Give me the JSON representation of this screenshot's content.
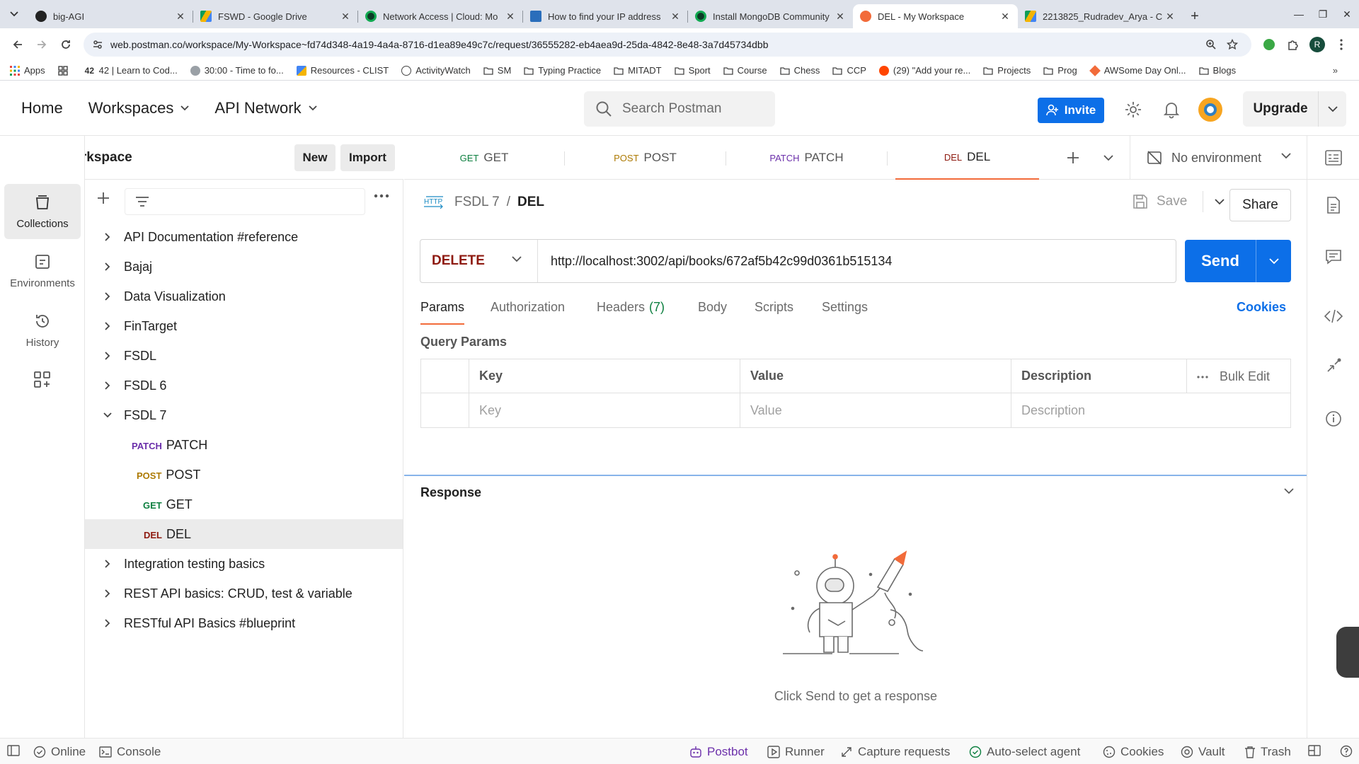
{
  "browser": {
    "tabs": [
      {
        "title": "big-AGI",
        "favicon_color": "#222222"
      },
      {
        "title": "FSWD - Google Drive",
        "favicon_color": "#f4b400"
      },
      {
        "title": "Network Access | Cloud: Mo",
        "favicon_color": "#13aa52"
      },
      {
        "title": "How to find your IP address",
        "favicon_color": "#2a6ebb"
      },
      {
        "title": "Install MongoDB Community",
        "favicon_color": "#13aa52"
      },
      {
        "title": "DEL - My Workspace",
        "favicon_color": "#f26b3a",
        "active": true
      },
      {
        "title": "2213825_Rudradev_Arya - C",
        "favicon_color": "#f4b400"
      }
    ],
    "url": "web.postman.co/workspace/My-Workspace~fd74d348-4a19-4a4a-8716-d1ea89e49c7c/request/36555282-eb4aea9d-25da-4842-8e48-3a7d45734dbb",
    "profile_initial": "R",
    "bookmarks": [
      {
        "label": "Apps",
        "icon": "apps-grid-icon"
      },
      {
        "label": "",
        "icon": "grid-icon"
      },
      {
        "label": "42 | Learn to Cod...",
        "icon": "code-icon"
      },
      {
        "label": "30:00 - Time to fo...",
        "icon": "timer-icon"
      },
      {
        "label": "Resources - CLIST",
        "icon": "clist-icon"
      },
      {
        "label": "ActivityWatch",
        "icon": "activitywatch-icon"
      },
      {
        "label": "SM",
        "icon": "folder-icon"
      },
      {
        "label": "Typing Practice",
        "icon": "folder-icon"
      },
      {
        "label": "MITADT",
        "icon": "folder-icon"
      },
      {
        "label": "Sport",
        "icon": "folder-icon"
      },
      {
        "label": "Course",
        "icon": "folder-icon"
      },
      {
        "label": "Chess",
        "icon": "folder-icon"
      },
      {
        "label": "CCP",
        "icon": "folder-icon"
      },
      {
        "label": "(29) \"Add your re...",
        "icon": "reddit-icon"
      },
      {
        "label": "Projects",
        "icon": "folder-icon"
      },
      {
        "label": "Prog",
        "icon": "folder-icon"
      },
      {
        "label": "AWSome Day Onl...",
        "icon": "aws-icon"
      },
      {
        "label": "Blogs",
        "icon": "folder-icon"
      }
    ]
  },
  "header": {
    "nav": {
      "home": "Home",
      "workspaces": "Workspaces",
      "api_network": "API Network"
    },
    "search_placeholder": "Search Postman",
    "invite": "Invite",
    "upgrade": "Upgrade"
  },
  "workspace": {
    "name": "My Workspace",
    "new": "New",
    "import": "Import"
  },
  "rail": {
    "collections": "Collections",
    "environments": "Environments",
    "history": "History"
  },
  "tree": [
    {
      "label": "API Documentation #reference",
      "type": "collection",
      "expanded": false
    },
    {
      "label": "Bajaj",
      "type": "collection",
      "expanded": false
    },
    {
      "label": "Data Visualization",
      "type": "collection",
      "expanded": false
    },
    {
      "label": "FinTarget",
      "type": "collection",
      "expanded": false
    },
    {
      "label": "FSDL",
      "type": "collection",
      "expanded": false
    },
    {
      "label": "FSDL 6",
      "type": "collection",
      "expanded": false
    },
    {
      "label": "FSDL 7",
      "type": "collection",
      "expanded": true
    },
    {
      "label": "PATCH",
      "type": "request",
      "method": "PATCH"
    },
    {
      "label": "POST",
      "type": "request",
      "method": "POST"
    },
    {
      "label": "GET",
      "type": "request",
      "method": "GET"
    },
    {
      "label": "DEL",
      "type": "request",
      "method": "DEL",
      "active": true
    },
    {
      "label": "Integration testing basics",
      "type": "collection",
      "expanded": false
    },
    {
      "label": "REST API basics: CRUD, test & variable",
      "type": "collection",
      "expanded": false
    },
    {
      "label": "RESTful API Basics #blueprint",
      "type": "collection",
      "expanded": false
    }
  ],
  "request_tabs": [
    {
      "method": "GET",
      "label": "GET"
    },
    {
      "method": "POST",
      "label": "POST"
    },
    {
      "method": "PATCH",
      "label": "PATCH"
    },
    {
      "method": "DEL",
      "label": "DEL",
      "active": true
    }
  ],
  "environment": "No environment",
  "request": {
    "http_badge": "HTTP",
    "collection": "FSDL 7",
    "separator": "/",
    "name": "DEL",
    "save": "Save",
    "share": "Share",
    "method": "DELETE",
    "url": "http://localhost:3002/api/books/672af5b42c99d0361b515134",
    "send": "Send",
    "subtabs": {
      "params": "Params",
      "authorization": "Authorization",
      "headers": "Headers",
      "headers_count": "(7)",
      "body": "Body",
      "scripts": "Scripts",
      "settings": "Settings"
    },
    "cookies": "Cookies",
    "query_params_title": "Query Params",
    "table": {
      "headers": {
        "key": "Key",
        "value": "Value",
        "description": "Description"
      },
      "placeholders": {
        "key": "Key",
        "value": "Value",
        "description": "Description"
      },
      "bulk_edit": "Bulk Edit"
    }
  },
  "response": {
    "title": "Response",
    "hint": "Click Send to get a response"
  },
  "statusbar": {
    "online": "Online",
    "console": "Console",
    "postbot": "Postbot",
    "runner": "Runner",
    "capture": "Capture requests",
    "auto_agent": "Auto-select agent",
    "cookies": "Cookies",
    "vault": "Vault",
    "trash": "Trash"
  },
  "colors": {
    "accent_blue": "#0c6fe8",
    "tab_underline": "#f26b3a",
    "method_get": "#0c7f3f",
    "method_post": "#ad7a03",
    "method_patch": "#6b2faa",
    "method_delete": "#8e1a10"
  }
}
